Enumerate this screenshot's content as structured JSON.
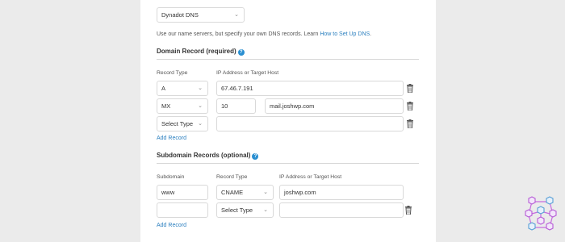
{
  "provider_select": {
    "value": "Dynadot DNS"
  },
  "intro": {
    "text": "Use our name servers, but specify your own DNS records. Learn ",
    "link": "How to Set Up DNS",
    "suffix": "."
  },
  "domain_section": {
    "title": "Domain Record (required)",
    "col_type": "Record Type",
    "col_target": "IP Address or Target Host",
    "rows": [
      {
        "type": "A",
        "value": "67.46.7.191"
      },
      {
        "type": "MX",
        "priority": "10",
        "value": "mail.joshwp.com"
      },
      {
        "type": "Select Type",
        "value": ""
      }
    ],
    "add_label": "Add Record"
  },
  "subdomain_section": {
    "title": "Subdomain Records (optional)",
    "col_subdomain": "Subdomain",
    "col_type": "Record Type",
    "col_target": "IP Address or Target Host",
    "rows": [
      {
        "subdomain": "www",
        "type": "CNAME",
        "value": "joshwp.com"
      },
      {
        "subdomain": "",
        "type": "Select Type",
        "value": ""
      }
    ],
    "add_label": "Add Record"
  },
  "icons": {
    "help": "question-circle-icon",
    "delete": "trash-icon",
    "dropdown": "chevron-down-icon",
    "watermark": "cubes-network-logo"
  },
  "colors": {
    "link": "#2a7fbf",
    "help_badge": "#2a8fd1",
    "background": "#ebebeb",
    "panel": "#ffffff"
  }
}
